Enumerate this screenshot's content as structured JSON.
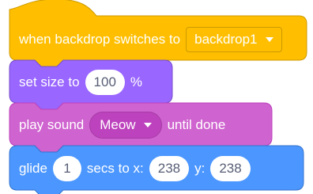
{
  "script": {
    "event": {
      "label": "when backdrop switches to",
      "dropdown_value": "backdrop1",
      "dropdown_icon": "chevron-down-icon",
      "color": "#ffbf00"
    },
    "set_size": {
      "label": "set size to",
      "value": "100",
      "unit": "%",
      "color": "#9966ff"
    },
    "play_sound": {
      "label": "play sound",
      "dropdown_value": "Meow",
      "dropdown_icon": "chevron-down-icon",
      "suffix": "until done",
      "color": "#cf63cf"
    },
    "glide": {
      "label": "glide",
      "secs_value": "1",
      "secs_label": "secs to x:",
      "x_value": "238",
      "y_label": "y:",
      "y_value": "238",
      "color": "#4c97ff"
    }
  }
}
